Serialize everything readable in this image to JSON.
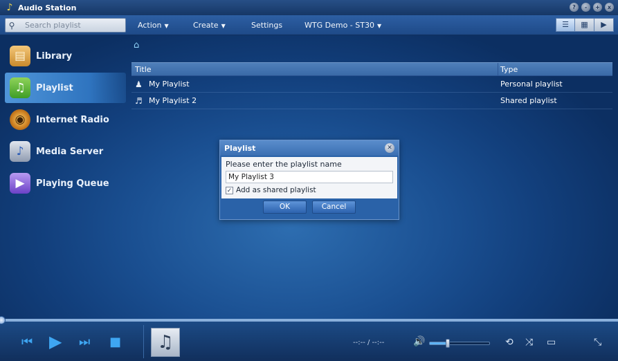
{
  "app": {
    "title": "Audio Station",
    "window_buttons": [
      "?",
      "-",
      "+",
      "x"
    ]
  },
  "toolbar": {
    "search_placeholder": "Search playlist",
    "menus": [
      {
        "label": "Action",
        "has_caret": true
      },
      {
        "label": "Create",
        "has_caret": true
      },
      {
        "label": "Settings",
        "has_caret": false
      },
      {
        "label": "WTG Demo - ST30",
        "has_caret": true
      }
    ],
    "view_modes": [
      "list-view-icon",
      "grid-view-icon",
      "cover-flow-icon"
    ],
    "active_view": 0
  },
  "sidebar": {
    "items": [
      {
        "label": "Library",
        "icon": "library-icon",
        "selected": false
      },
      {
        "label": "Playlist",
        "icon": "playlist-icon",
        "selected": true
      },
      {
        "label": "Internet Radio",
        "icon": "internet-radio-icon",
        "selected": false
      },
      {
        "label": "Media Server",
        "icon": "media-server-icon",
        "selected": false
      },
      {
        "label": "Playing Queue",
        "icon": "playing-queue-icon",
        "selected": false
      }
    ]
  },
  "breadcrumb": {
    "icon": "home-icon"
  },
  "list": {
    "columns": [
      "Title",
      "Type"
    ],
    "rows": [
      {
        "title": "My Playlist",
        "type": "Personal playlist",
        "icon": "personal-playlist-icon"
      },
      {
        "title": "My Playlist 2",
        "type": "Shared playlist",
        "icon": "shared-playlist-icon"
      }
    ]
  },
  "dialog": {
    "title": "Playlist",
    "label": "Please enter the playlist name",
    "input_value": "My Playlist 3",
    "checkbox_label": "Add as shared playlist",
    "checkbox_checked": true,
    "ok_label": "OK",
    "cancel_label": "Cancel"
  },
  "player": {
    "time": "--:-- / --:--",
    "volume_fraction": 0.3,
    "seek_fraction": 0
  },
  "colors": {
    "accent": "#3ea6f2",
    "background": "#1a4f91",
    "selected": "#2f74bf"
  }
}
